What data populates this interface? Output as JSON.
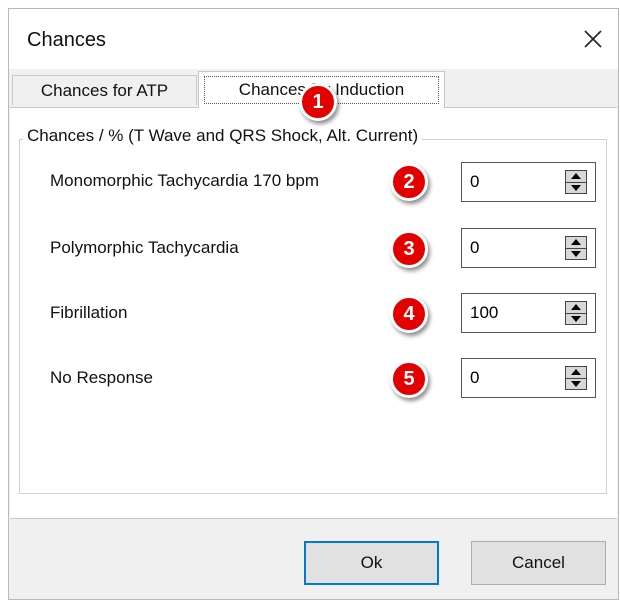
{
  "dialog": {
    "title": "Chances"
  },
  "tabs": [
    {
      "label": "Chances for ATP",
      "active": false
    },
    {
      "label": "Chances for Induction",
      "active": true
    }
  ],
  "group": {
    "legend": "Chances / % (T Wave and QRS Shock, Alt. Current)"
  },
  "rows": [
    {
      "label": "Monomorphic Tachycardia 170 bpm",
      "value": "0",
      "marker": "2"
    },
    {
      "label": "Polymorphic Tachycardia",
      "value": "0",
      "marker": "3"
    },
    {
      "label": "Fibrillation",
      "value": "100",
      "marker": "4"
    },
    {
      "label": "No Response",
      "value": "0",
      "marker": "5"
    }
  ],
  "tab_marker": "1",
  "buttons": {
    "ok": "Ok",
    "cancel": "Cancel"
  },
  "colors": {
    "marker": "#e30000",
    "default_button_border": "#0078d7"
  },
  "icons": [
    "close-icon",
    "spin-up-icon",
    "spin-down-icon"
  ]
}
